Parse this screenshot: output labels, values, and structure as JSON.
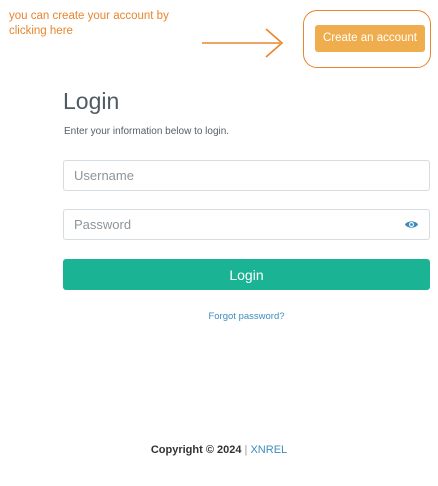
{
  "annotation": {
    "text": "you can create your account by clicking here",
    "color": "#e8852d"
  },
  "header": {
    "create_account_label": "Create an account",
    "create_account_color": "#f0ad4e"
  },
  "login": {
    "title": "Login",
    "subtitle": "Enter your information below to login.",
    "username_placeholder": "Username",
    "password_placeholder": "Password",
    "show_password_icon": "eye-icon",
    "submit_label": "Login",
    "submit_color": "#1ab394",
    "forgot_label": "Forgot password?"
  },
  "footer": {
    "copyright": "Copyright © 2024",
    "separator": "|",
    "brand": "XNREL"
  }
}
